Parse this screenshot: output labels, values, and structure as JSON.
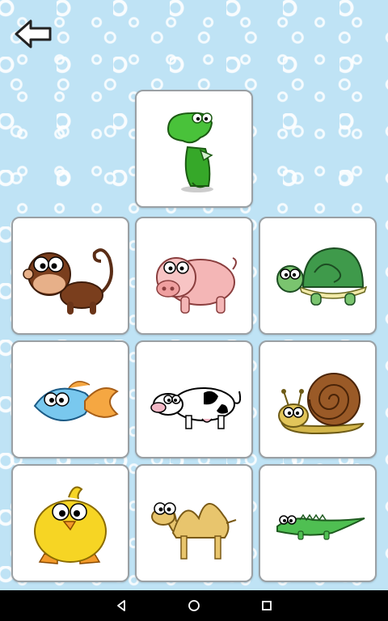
{
  "app": {
    "back_icon": "arrow-left-icon",
    "cards": [
      {
        "animal": "dinosaur",
        "icon": "dinosaur-icon"
      },
      {
        "animal": "monkey",
        "icon": "monkey-icon"
      },
      {
        "animal": "pig",
        "icon": "pig-icon"
      },
      {
        "animal": "turtle",
        "icon": "turtle-icon"
      },
      {
        "animal": "fish",
        "icon": "fish-icon"
      },
      {
        "animal": "cow",
        "icon": "cow-icon"
      },
      {
        "animal": "snail",
        "icon": "snail-icon"
      },
      {
        "animal": "chick",
        "icon": "chick-icon"
      },
      {
        "animal": "camel",
        "icon": "camel-icon"
      },
      {
        "animal": "crocodile",
        "icon": "crocodile-icon"
      }
    ]
  },
  "system_nav": {
    "buttons": [
      "back-triangle-icon",
      "home-circle-icon",
      "recents-square-icon"
    ]
  },
  "colors": {
    "background": "#bfe3f5",
    "card_border": "#9aa0a4",
    "nav_bar": "#000000"
  }
}
